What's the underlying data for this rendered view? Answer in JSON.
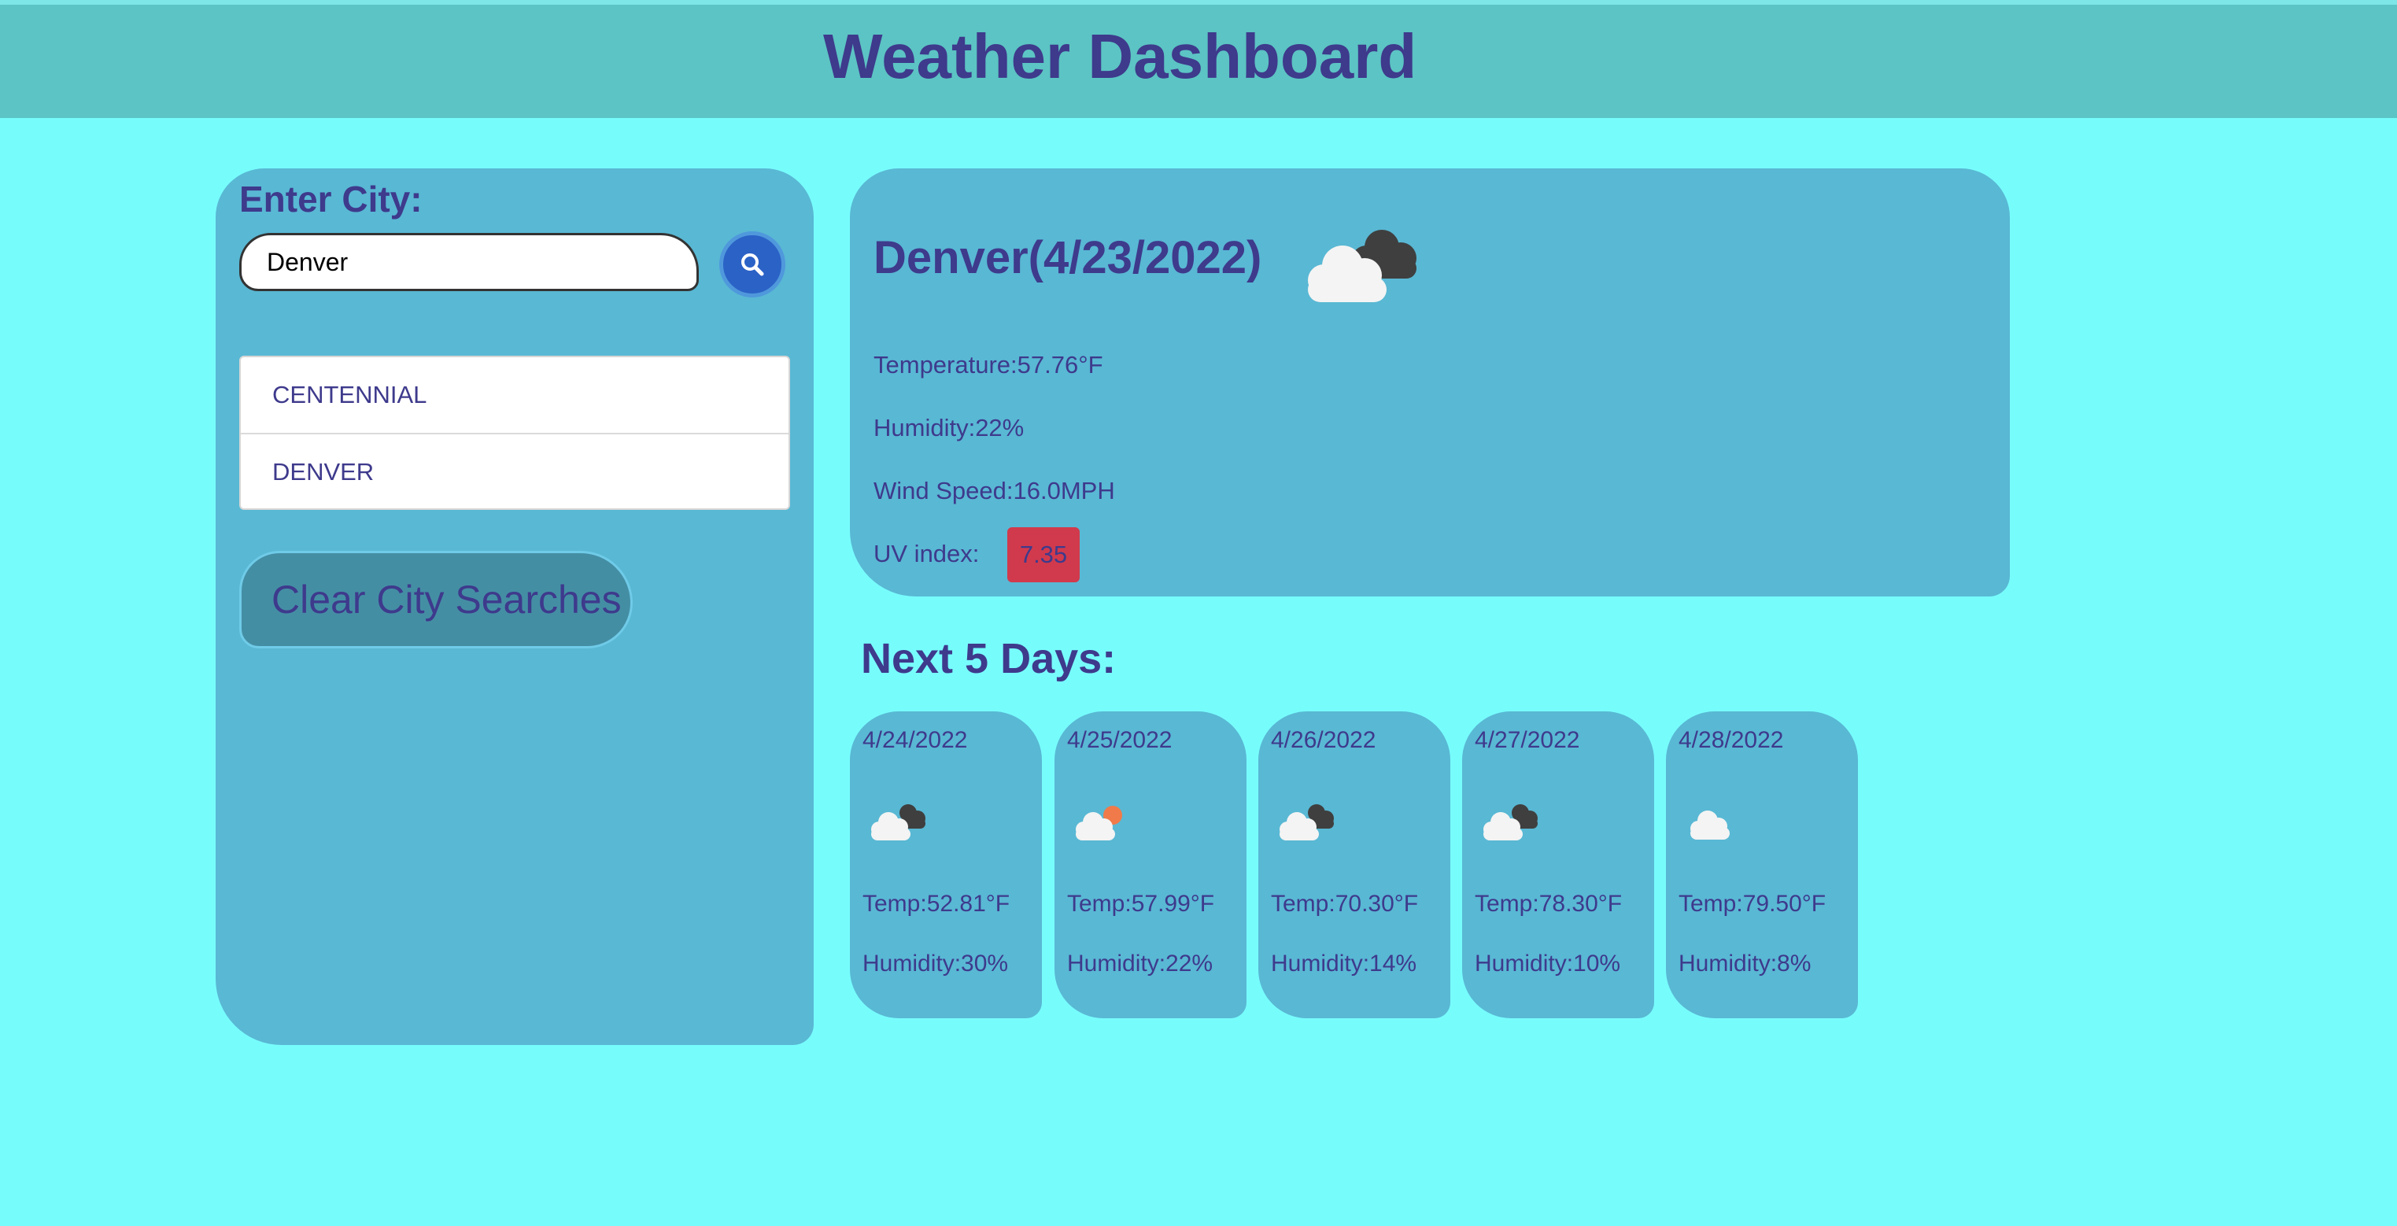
{
  "header": {
    "title": "Weather Dashboard"
  },
  "sidebar": {
    "label": "Enter City:",
    "input_value": "Denver",
    "search_icon": "search-icon",
    "history": [
      {
        "label": "CENTENNIAL"
      },
      {
        "label": "DENVER"
      }
    ],
    "clear_label": "Clear City Searches"
  },
  "current": {
    "title": "Denver(4/23/2022)",
    "icon": "broken-clouds-icon",
    "temperature": "Temperature:57.76°F",
    "humidity": "Humidity:22%",
    "wind": "Wind Speed:16.0MPH",
    "uv_label": "UV index:",
    "uv_value": "7.35"
  },
  "forecast": {
    "title": "Next 5 Days:",
    "days": [
      {
        "date": "4/24/2022",
        "icon": "broken-clouds-icon",
        "temp": "Temp:52.81°F",
        "humidity": "Humidity:30%"
      },
      {
        "date": "4/25/2022",
        "icon": "few-clouds-icon",
        "temp": "Temp:57.99°F",
        "humidity": "Humidity:22%"
      },
      {
        "date": "4/26/2022",
        "icon": "broken-clouds-icon",
        "temp": "Temp:70.30°F",
        "humidity": "Humidity:14%"
      },
      {
        "date": "4/27/2022",
        "icon": "broken-clouds-icon",
        "temp": "Temp:78.30°F",
        "humidity": "Humidity:10%"
      },
      {
        "date": "4/28/2022",
        "icon": "cloud-icon",
        "temp": "Temp:79.50°F",
        "humidity": "Humidity:8%"
      }
    ]
  },
  "colors": {
    "background": "#77fcfc",
    "header": "#5cc4c4",
    "panel": "#59b8d4",
    "text": "#3e3a8c",
    "uv_badge": "#d13a4c",
    "search_button": "#2b62c6"
  }
}
